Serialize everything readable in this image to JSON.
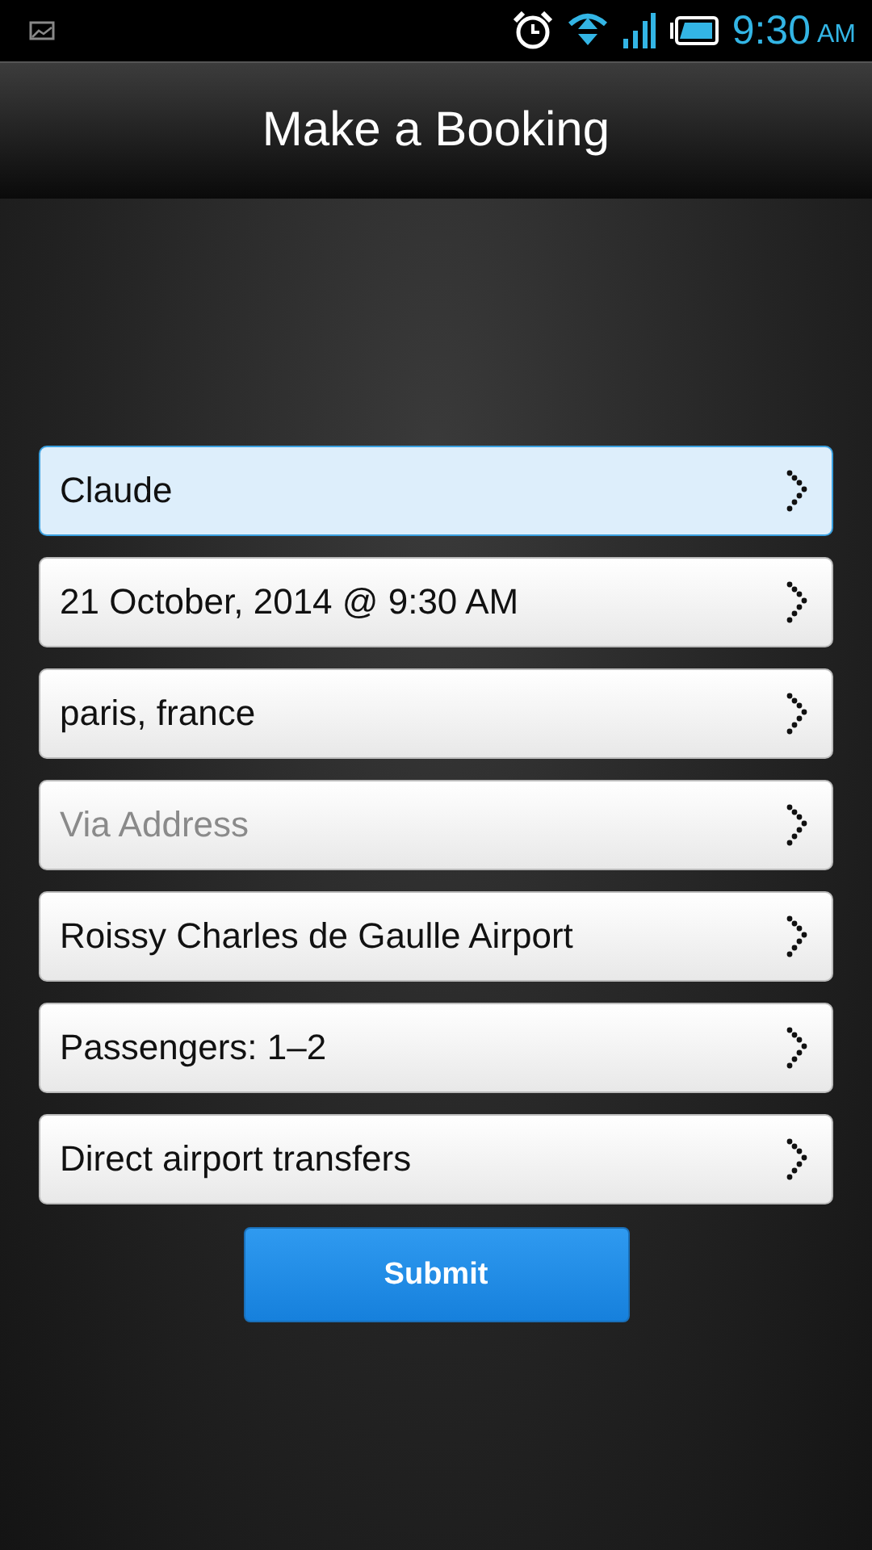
{
  "status_bar": {
    "time": "9:30",
    "period": "AM"
  },
  "header": {
    "title": "Make a Booking"
  },
  "fields": [
    {
      "value": "Claude",
      "selected": true
    },
    {
      "value": "21 October, 2014 @ 9:30 AM",
      "selected": false
    },
    {
      "value": "paris, france",
      "selected": false
    },
    {
      "placeholder": "Via Address",
      "selected": false
    },
    {
      "value": "Roissy Charles de Gaulle Airport",
      "selected": false
    },
    {
      "value": "Passengers: 1–2",
      "selected": false
    },
    {
      "value": "Direct airport transfers",
      "selected": false
    }
  ],
  "submit": {
    "label": "Submit"
  }
}
